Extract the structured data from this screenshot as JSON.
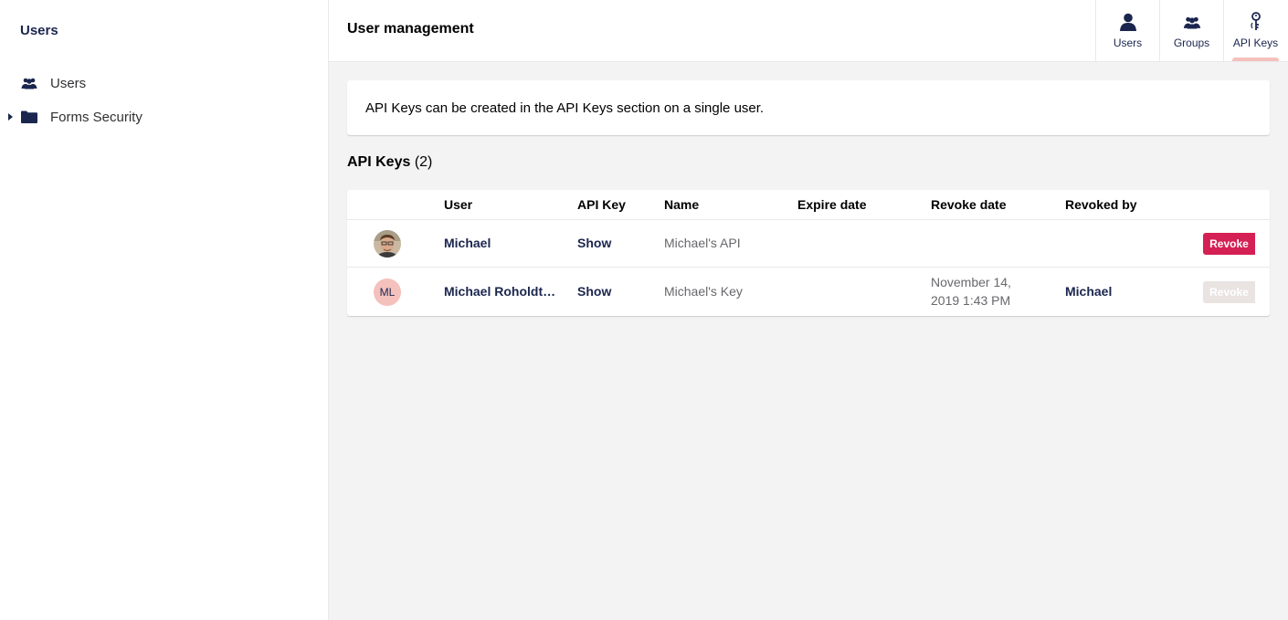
{
  "sidebar": {
    "title": "Users",
    "items": [
      {
        "label": "Users",
        "icon": "users-icon",
        "expandable": false
      },
      {
        "label": "Forms Security",
        "icon": "folder-icon",
        "expandable": true
      }
    ]
  },
  "header": {
    "title": "User management",
    "tabs": [
      {
        "label": "Users",
        "icon": "user-icon",
        "active": false
      },
      {
        "label": "Groups",
        "icon": "users-icon",
        "active": false
      },
      {
        "label": "API Keys",
        "icon": "key-icon",
        "active": true
      }
    ]
  },
  "info": {
    "text": "API Keys can be created in the API Keys section on a single user."
  },
  "section": {
    "title": "API Keys",
    "count": "(2)"
  },
  "table": {
    "columns": [
      "User",
      "API Key",
      "Name",
      "Expire date",
      "Revoke date",
      "Revoked by"
    ],
    "rows": [
      {
        "avatar": "photo",
        "user": "Michael",
        "api_key": "Show",
        "name": "Michael's API",
        "expire_date": "",
        "revoke_date_line1": "",
        "revoke_date_line2": "",
        "revoked_by": "",
        "action": "Revoke",
        "action_enabled": true
      },
      {
        "avatar": "initials",
        "initials": "ML",
        "user": "Michael Roholdt…",
        "api_key": "Show",
        "name": "Michael's Key",
        "expire_date": "",
        "revoke_date_line1": "November 14,",
        "revoke_date_line2": "2019 1:43 PM",
        "revoked_by": "Michael",
        "action": "Revoke",
        "action_enabled": false
      }
    ]
  },
  "colors": {
    "primary": "#1b264f",
    "danger": "#d42054",
    "active_indicator": "#f5c1bc",
    "background": "#f4f3f3"
  }
}
